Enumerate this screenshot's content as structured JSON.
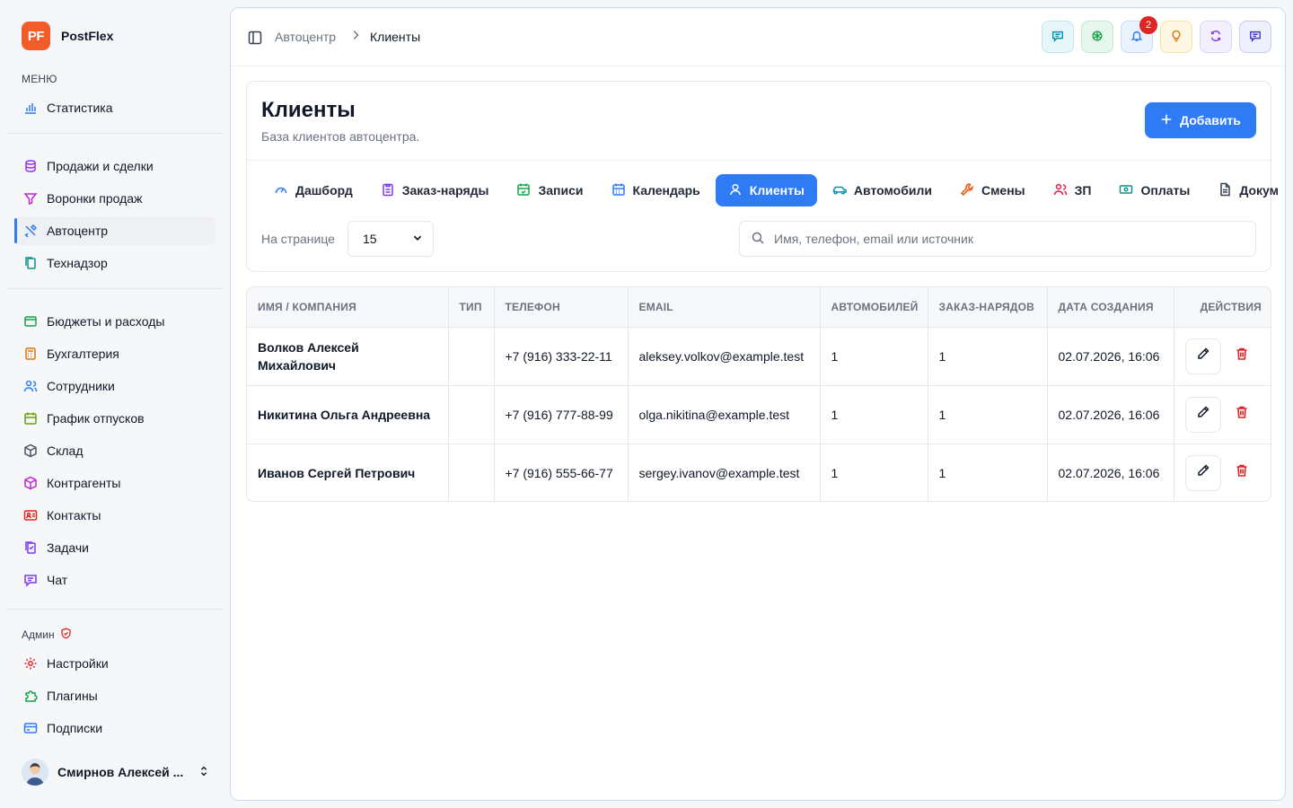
{
  "brand": {
    "logo": "PF",
    "name": "PostFlex"
  },
  "sidebar": {
    "menu_label": "МЕНЮ",
    "items": [
      {
        "label": "Статистика",
        "icon": "bar-chart-icon",
        "color": "#2f7bf6"
      },
      {
        "label": "Продажи и сделки",
        "icon": "database-icon",
        "color": "#9333ea"
      },
      {
        "label": "Воронки продаж",
        "icon": "funnel-icon",
        "color": "#c026d3"
      },
      {
        "label": "Автоцентр",
        "icon": "wrench-screwdriver-icon",
        "color": "#2f7bf6",
        "active": true
      },
      {
        "label": "Технадзор",
        "icon": "clipboard-copy-icon",
        "color": "#0d9488"
      },
      {
        "label": "Бюджеты и расходы",
        "icon": "wallet-icon",
        "color": "#16a34a"
      },
      {
        "label": "Бухгалтерия",
        "icon": "calculator-icon",
        "color": "#d97706"
      },
      {
        "label": "Сотрудники",
        "icon": "users-icon",
        "color": "#2f7bf6"
      },
      {
        "label": "График отпусков",
        "icon": "calendar-icon",
        "color": "#65a30d"
      },
      {
        "label": "Склад",
        "icon": "box-icon",
        "color": "#4b5563"
      },
      {
        "label": "Контрагенты",
        "icon": "package-icon",
        "color": "#c026d3"
      },
      {
        "label": "Контакты",
        "icon": "contact-card-icon",
        "color": "#dc2626"
      },
      {
        "label": "Задачи",
        "icon": "tasks-icon",
        "color": "#7c3aed"
      },
      {
        "label": "Чат",
        "icon": "chat-icon",
        "color": "#7c3aed"
      }
    ],
    "admin_label": "Админ",
    "admin_items": [
      {
        "label": "Настройки",
        "icon": "settings-icon",
        "color": "#dc2626"
      },
      {
        "label": "Плагины",
        "icon": "puzzle-icon",
        "color": "#16a34a"
      },
      {
        "label": "Подписки",
        "icon": "credit-card-icon",
        "color": "#2f7bf6"
      }
    ],
    "user_name": "Смирнов Алексей ..."
  },
  "header": {
    "breadcrumb_parent": "Автоцентр",
    "breadcrumb_current": "Клиенты",
    "notification_count": "2"
  },
  "page": {
    "title": "Клиенты",
    "subtitle": "База клиентов автоцентра.",
    "add_label": "Добавить"
  },
  "tabs": [
    {
      "label": "Дашборд",
      "icon": "gauge-icon",
      "color": "#2f7bf6"
    },
    {
      "label": "Заказ-наряды",
      "icon": "clipboard-list-icon",
      "color": "#7c3aed"
    },
    {
      "label": "Записи",
      "icon": "calendar-check-icon",
      "color": "#16a34a"
    },
    {
      "label": "Календарь",
      "icon": "calendar-icon",
      "color": "#2f7bf6"
    },
    {
      "label": "Клиенты",
      "icon": "user-icon",
      "color": "#ffffff",
      "active": true
    },
    {
      "label": "Автомобили",
      "icon": "car-icon",
      "color": "#0891b2"
    },
    {
      "label": "Смены",
      "icon": "wrench-icon",
      "color": "#ea580c"
    },
    {
      "label": "ЗП",
      "icon": "users-icon",
      "color": "#e11d48"
    },
    {
      "label": "Оплаты",
      "icon": "banknote-icon",
      "color": "#0d9488"
    },
    {
      "label": "Докум",
      "icon": "document-icon",
      "color": "#374151"
    }
  ],
  "filters": {
    "per_page_label": "На странице",
    "per_page_value": "15",
    "search_placeholder": "Имя, телефон, email или источник"
  },
  "table": {
    "columns": [
      "ИМЯ / КОМПАНИЯ",
      "ТИП",
      "ТЕЛЕФОН",
      "EMAIL",
      "АВТОМОБИЛЕЙ",
      "ЗАКАЗ-НАРЯДОВ",
      "ДАТА СОЗДАНИЯ",
      "ДЕЙСТВИЯ"
    ],
    "rows": [
      {
        "name": "Волков Алексей Михайлович",
        "type": "",
        "phone": "+7 (916) 333-22-11",
        "email": "aleksey.volkov@example.test",
        "cars": "1",
        "orders": "1",
        "created": "02.07.2026, 16:06"
      },
      {
        "name": "Никитина Ольга Андреевна",
        "type": "",
        "phone": "+7 (916) 777-88-99",
        "email": "olga.nikitina@example.test",
        "cars": "1",
        "orders": "1",
        "created": "02.07.2026, 16:06"
      },
      {
        "name": "Иванов Сергей Петрович",
        "type": "",
        "phone": "+7 (916) 555-66-77",
        "email": "sergey.ivanov@example.test",
        "cars": "1",
        "orders": "1",
        "created": "02.07.2026, 16:06"
      }
    ]
  },
  "colors": {
    "accent": "#2f7bf6",
    "brand": "#f25c2a",
    "danger": "#dc2626"
  }
}
